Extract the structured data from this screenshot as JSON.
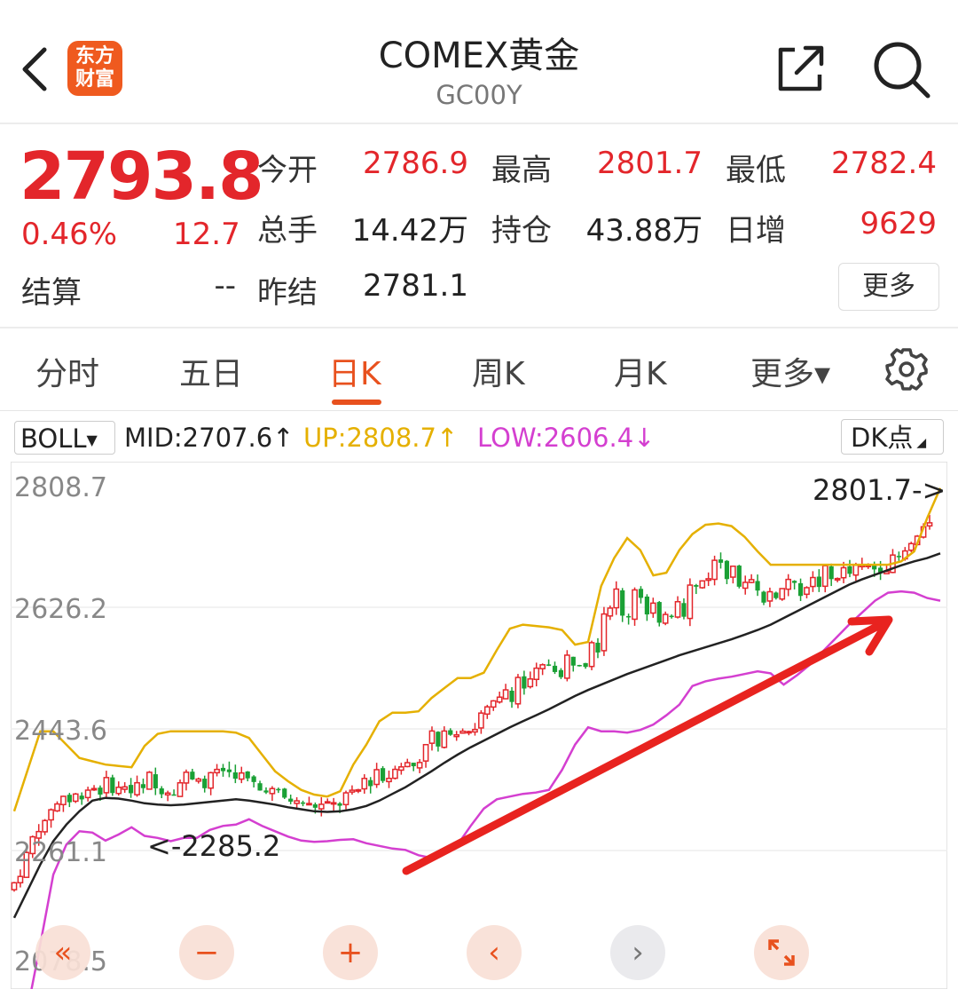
{
  "header": {
    "back_icon": "chevron-left-icon",
    "logo_line1": "东方",
    "logo_line2": "财富",
    "title": "COMEX黄金",
    "code": "GC00Y",
    "share_icon": "share-icon",
    "search_icon": "search-icon"
  },
  "quote": {
    "price": "2793.8",
    "change_pct": "0.46%",
    "change": "12.7",
    "settle_label": "结算",
    "settle_value": "--",
    "open_label": "今开",
    "open_value": "2786.9",
    "high_label": "最高",
    "high_value": "2801.7",
    "low_label": "最低",
    "low_value": "2782.4",
    "volume_label": "总手",
    "volume_value": "14.42万",
    "oi_label": "持仓",
    "oi_value": "43.88万",
    "daily_inc_label": "日增",
    "daily_inc_value": "9629",
    "prev_settle_label": "昨结",
    "prev_settle_value": "2781.1",
    "more_label": "更多"
  },
  "tabs": [
    "分时",
    "五日",
    "日K",
    "周K",
    "月K",
    "更多▾"
  ],
  "active_tab": "日K",
  "indicator": {
    "name": "BOLL",
    "mid": "MID:2707.6↑",
    "up": "UP:2808.7↑",
    "low": "LOW:2606.4↓",
    "dk_label": "DK点"
  },
  "colors": {
    "up": "#e3262b",
    "down": "#1aa035",
    "mid": "#222222",
    "upper_band": "#e5b000",
    "lower_band": "#d43fd0",
    "accent": "#e8511e"
  },
  "chart_data": {
    "type": "candlestick",
    "y_ticks": [
      "2808.7",
      "2626.2",
      "2443.6",
      "2261.1",
      "2078.5"
    ],
    "ylim": [
      2078.5,
      2808.7
    ],
    "high_annotation": "2801.7->",
    "low_annotation": "<-2285.2",
    "annotation_arrow": "red trend arrow pointing upward",
    "mid_series": [
      2160,
      2200,
      2240,
      2275,
      2300,
      2320,
      2336,
      2340,
      2339,
      2336,
      2332,
      2330,
      2329,
      2330,
      2332,
      2334,
      2336,
      2338,
      2336,
      2333,
      2330,
      2326,
      2323,
      2320,
      2319,
      2320,
      2323,
      2328,
      2336,
      2346,
      2356,
      2368,
      2380,
      2393,
      2405,
      2416,
      2426,
      2436,
      2446,
      2455,
      2464,
      2473,
      2483,
      2493,
      2502,
      2510,
      2518,
      2526,
      2533,
      2540,
      2547,
      2554,
      2560,
      2566,
      2572,
      2578,
      2585,
      2592,
      2600,
      2610,
      2620,
      2630,
      2640,
      2650,
      2660,
      2668,
      2675,
      2682,
      2689,
      2695,
      2700,
      2707
    ],
    "upper_series": [
      2320,
      2380,
      2440,
      2440,
      2420,
      2400,
      2395,
      2390,
      2388,
      2386,
      2418,
      2436,
      2440,
      2440,
      2440,
      2440,
      2440,
      2438,
      2430,
      2405,
      2380,
      2365,
      2352,
      2345,
      2342,
      2350,
      2390,
      2420,
      2455,
      2468,
      2468,
      2470,
      2490,
      2505,
      2520,
      2520,
      2528,
      2562,
      2594,
      2600,
      2598,
      2596,
      2592,
      2570,
      2574,
      2658,
      2700,
      2730,
      2712,
      2674,
      2678,
      2712,
      2736,
      2750,
      2752,
      2748,
      2732,
      2710,
      2690,
      2690,
      2690,
      2690,
      2690,
      2690,
      2690,
      2690,
      2690,
      2690,
      2695,
      2710,
      2760,
      2805
    ],
    "lower_series": [
      2000,
      2020,
      2120,
      2225,
      2270,
      2290,
      2288,
      2276,
      2285,
      2296,
      2283,
      2280,
      2275,
      2280,
      2280,
      2292,
      2298,
      2300,
      2308,
      2298,
      2290,
      2282,
      2276,
      2274,
      2275,
      2277,
      2278,
      2272,
      2268,
      2264,
      2262,
      2254,
      2250,
      2262,
      2270,
      2298,
      2324,
      2338,
      2342,
      2346,
      2348,
      2352,
      2382,
      2420,
      2446,
      2440,
      2440,
      2438,
      2442,
      2450,
      2464,
      2480,
      2508,
      2515,
      2519,
      2522,
      2526,
      2530,
      2527,
      2510,
      2524,
      2540,
      2560,
      2580,
      2600,
      2618,
      2636,
      2648,
      2650,
      2648,
      2640,
      2636
    ],
    "candles_summary": "Daily K-line candles rising from about 2240 to 2801.7 over the visible range"
  },
  "controls": {
    "prev_page_icon": "double-chevron-left-icon",
    "zoom_out_icon": "minus-icon",
    "zoom_in_icon": "plus-icon",
    "prev_icon": "chevron-left-icon",
    "next_icon": "chevron-right-icon",
    "fullscreen_icon": "expand-icon"
  }
}
